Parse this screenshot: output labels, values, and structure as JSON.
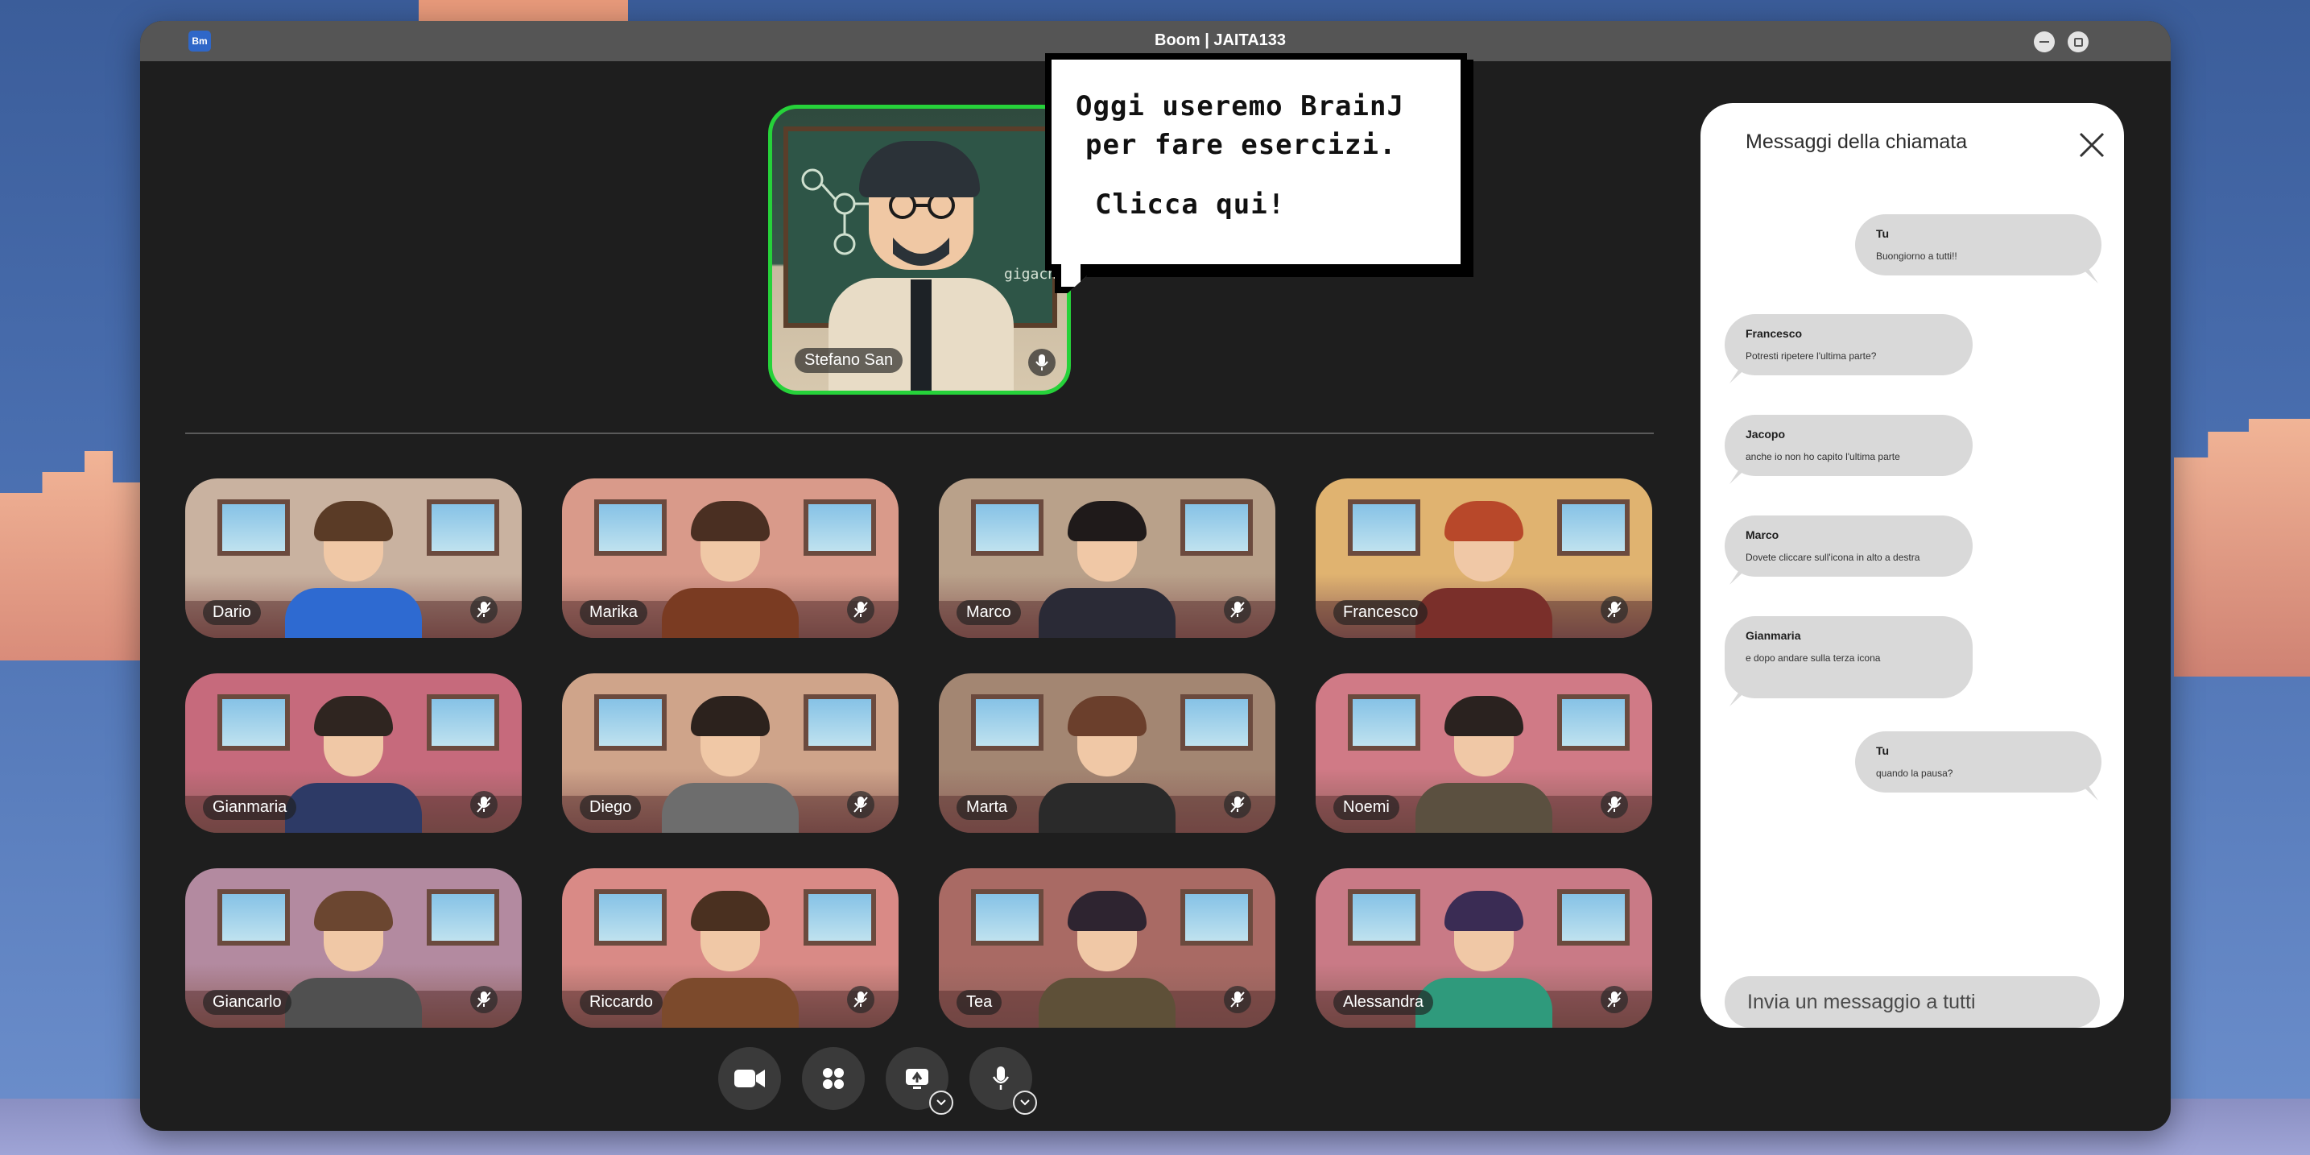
{
  "window": {
    "app_badge": "Bm",
    "title": "Boom | JAITA133"
  },
  "speaker": {
    "name": "Stefano San",
    "chalk_text": "gigacn",
    "bubble": {
      "line1": "Oggi useremo BrainJ",
      "line2": "per fare esercizi.",
      "line3": "Clicca qui!"
    }
  },
  "participants": [
    {
      "name": "Dario",
      "hair": "#5a3b26",
      "shirt": "#2e6ad1",
      "wall": "#c9b2a0"
    },
    {
      "name": "Marika",
      "hair": "#4a2f22",
      "shirt": "#7a3b22",
      "wall": "#d99a8a"
    },
    {
      "name": "Marco",
      "hair": "#1f1a1a",
      "shirt": "#2a2a36",
      "wall": "#b9a18a"
    },
    {
      "name": "Francesco",
      "hair": "#b8482a",
      "shirt": "#7a2f2a",
      "wall": "#e0b370"
    },
    {
      "name": "Gianmaria",
      "hair": "#2f2520",
      "shirt": "#2d3a66",
      "wall": "#c66a7c"
    },
    {
      "name": "Diego",
      "hair": "#2c221d",
      "shirt": "#6d6d6d",
      "wall": "#cfa48a"
    },
    {
      "name": "Marta",
      "hair": "#6b3f2c",
      "shirt": "#2a2a2a",
      "wall": "#a38672"
    },
    {
      "name": "Noemi",
      "hair": "#2a221f",
      "shirt": "#5b5040",
      "wall": "#d07a86"
    },
    {
      "name": "Giancarlo",
      "hair": "#6b4630",
      "shirt": "#505050",
      "wall": "#b38aa0"
    },
    {
      "name": "Riccardo",
      "hair": "#4a3020",
      "shirt": "#7c4a2c",
      "wall": "#d98a86"
    },
    {
      "name": "Tea",
      "hair": "#2e2430",
      "shirt": "#5e5038",
      "wall": "#a96a64"
    },
    {
      "name": "Alessandra",
      "hair": "#3a2c54",
      "shirt": "#2f9a7c",
      "wall": "#c97a86"
    }
  ],
  "controls": [
    {
      "name": "camera-button",
      "icon": "video-camera-icon"
    },
    {
      "name": "apps-button",
      "icon": "grid-icon"
    },
    {
      "name": "share-screen-button",
      "icon": "screen-share-icon"
    },
    {
      "name": "microphone-button",
      "icon": "microphone-icon"
    }
  ],
  "chat": {
    "title": "Messaggi della chiamata",
    "messages": [
      {
        "author": "Tu",
        "text": "Buongiorno a tutti!!",
        "mine": true
      },
      {
        "author": "Francesco",
        "text": "Potresti ripetere l'ultima parte?",
        "mine": false
      },
      {
        "author": "Jacopo",
        "text": "anche io non ho capito l'ultima parte",
        "mine": false
      },
      {
        "author": "Marco",
        "text": "Dovete cliccare sull'icona in alto a destra",
        "mine": false
      },
      {
        "author": "Gianmaria",
        "text": "e dopo andare sulla terza icona",
        "mine": false
      },
      {
        "author": "Tu",
        "text": "quando la pausa?",
        "mine": true
      }
    ],
    "input_placeholder": "Invia un messaggio a tutti"
  },
  "colors": {
    "speaker_border": "#26d23a",
    "window_bg": "#1e1e1e",
    "titlebar": "#555555",
    "chat_bubble": "#d9d9d9"
  }
}
